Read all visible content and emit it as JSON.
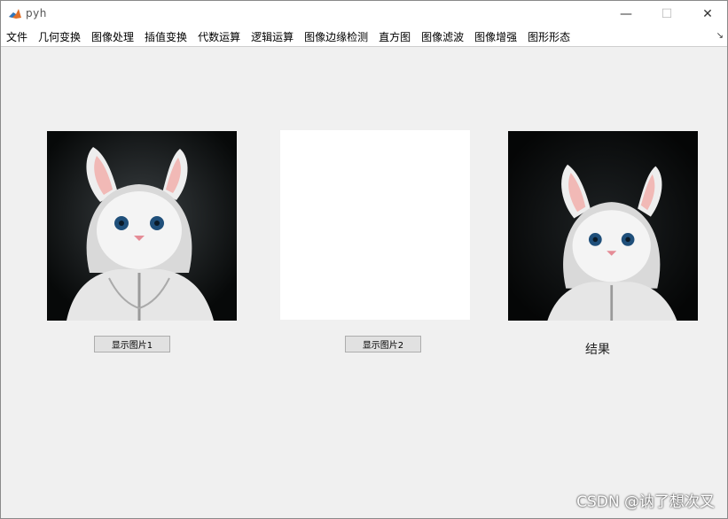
{
  "window": {
    "title": "pyh",
    "min_glyph": "—",
    "max_glyph": "☐",
    "close_glyph": "✕"
  },
  "menu": {
    "items": [
      "文件",
      "几何变换",
      "图像处理",
      "插值变换",
      "代数运算",
      "逻辑运算",
      "图像边缘检测",
      "直方图",
      "图像滤波",
      "图像增强",
      "图形形态"
    ]
  },
  "toolbar": {
    "arrow_glyph": "↘"
  },
  "buttons": {
    "show_image_1": "显示图片1",
    "show_image_2": "显示图片2"
  },
  "result_label": "结果",
  "watermark": "CSDN @讷了想次又",
  "colors": {
    "window_bg": "#f0f0f0",
    "titlebar_bg": "#ffffff",
    "button_bg": "#e1e1e1",
    "button_border": "#adadad"
  }
}
